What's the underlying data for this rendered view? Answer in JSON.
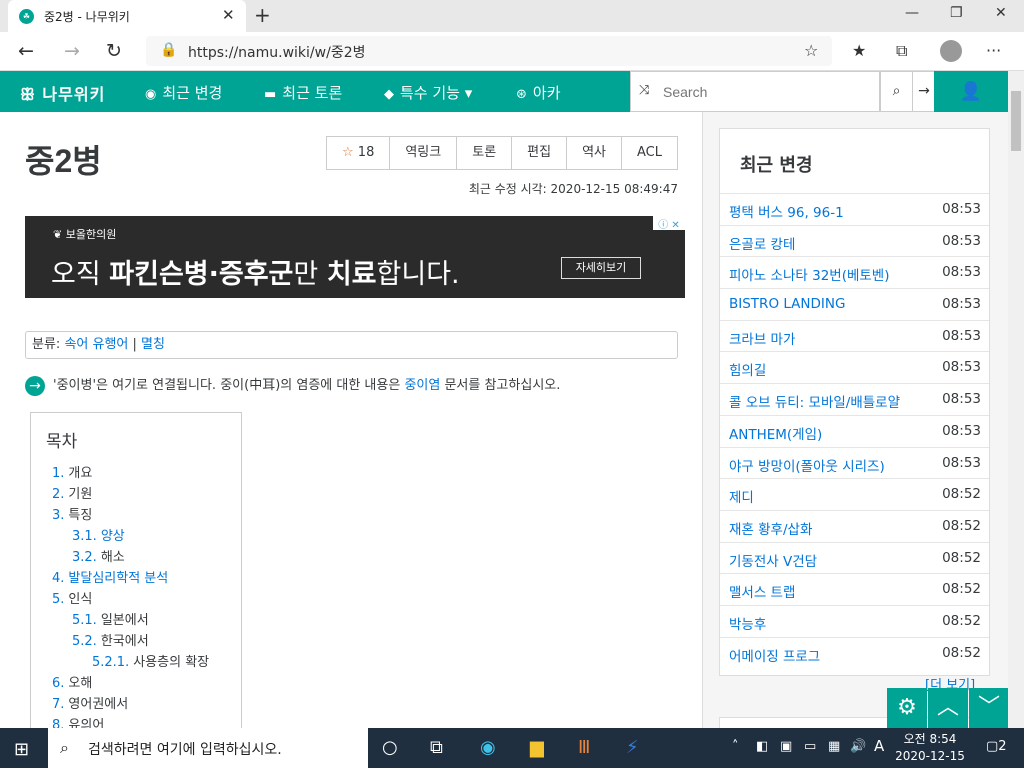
{
  "browser": {
    "tab_title": "중2병 - 나무위키",
    "tab_favicon": "namu-icon",
    "url": "https://namu.wiki/w/중2병",
    "window_buttons": [
      "—",
      "❐",
      "✕"
    ]
  },
  "nav": {
    "logo": "나무위키",
    "items": [
      {
        "label": "최근 변경",
        "icon": "compass-icon"
      },
      {
        "label": "최근 토론",
        "icon": "comment-icon"
      },
      {
        "label": "특수 기능",
        "icon": "cube-icon"
      },
      {
        "label": "아카",
        "icon": "arca-icon"
      }
    ],
    "search_placeholder": "Search",
    "accent": "#00a495"
  },
  "article": {
    "title": "중2병",
    "star_count": "18",
    "actions": [
      "역링크",
      "토론",
      "편집",
      "역사",
      "ACL"
    ],
    "last_modified": "최근 수정 시각: 2020-12-15 08:49:47",
    "ad": {
      "brand": "보올한의원",
      "copy_1": "오직 ",
      "copy_2": "파킨슨병·증후군",
      "copy_3": "만 ",
      "copy_4": "치료",
      "copy_5": "합니다.",
      "button": "자세히보기"
    },
    "category_label": "분류",
    "categories": [
      "속어 유행어",
      "멸칭"
    ],
    "redirect_1": "'중이병'은 여기로 연결됩니다. 중이(中耳)의 염증에 대한 내용은 ",
    "redirect_link": "중이염",
    "redirect_2": " 문서를 참고하십시오.",
    "toc_title": "목차",
    "toc": [
      {
        "num": "1.",
        "label": "개요",
        "level": 1,
        "linked": false
      },
      {
        "num": "2.",
        "label": "기원",
        "level": 1,
        "linked": false
      },
      {
        "num": "3.",
        "label": "특징",
        "level": 1,
        "linked": false
      },
      {
        "num": "3.1.",
        "label": "양상",
        "level": 2,
        "linked": true
      },
      {
        "num": "3.2.",
        "label": "해소",
        "level": 2,
        "linked": false
      },
      {
        "num": "4.",
        "label": "발달심리학적 분석",
        "level": 1,
        "linked": true
      },
      {
        "num": "5.",
        "label": "인식",
        "level": 1,
        "linked": false
      },
      {
        "num": "5.1.",
        "label": "일본에서",
        "level": 2,
        "linked": false
      },
      {
        "num": "5.2.",
        "label": "한국에서",
        "level": 2,
        "linked": false
      },
      {
        "num": "5.2.1.",
        "label": "사용층의 확장",
        "level": 3,
        "linked": false
      },
      {
        "num": "6.",
        "label": "오해",
        "level": 1,
        "linked": false
      },
      {
        "num": "7.",
        "label": "영어권에서",
        "level": 1,
        "linked": false
      },
      {
        "num": "8.",
        "label": "유의어",
        "level": 1,
        "linked": false
      }
    ]
  },
  "sidebar": {
    "title": "최근 변경",
    "more": "[더 보기]",
    "items": [
      {
        "name": "평택 버스 96, 96-1",
        "time": "08:53"
      },
      {
        "name": "은골로 캉테",
        "time": "08:53"
      },
      {
        "name": "피아노 소나타 32번(베토벤)",
        "time": "08:53"
      },
      {
        "name": "BISTRO LANDING",
        "time": "08:53"
      },
      {
        "name": "크라브 마가",
        "time": "08:53"
      },
      {
        "name": "힘의길",
        "time": "08:53"
      },
      {
        "name": "콜 오브 듀티: 모바일/배틀로얄",
        "time": "08:53"
      },
      {
        "name": "ANTHEM(게임)",
        "time": "08:53"
      },
      {
        "name": "야구 방망이(폴아웃 시리즈)",
        "time": "08:53"
      },
      {
        "name": "제디",
        "time": "08:52"
      },
      {
        "name": "재혼 황후/삽화",
        "time": "08:52"
      },
      {
        "name": "기동전사 V건담",
        "time": "08:52"
      },
      {
        "name": "맬서스 트랩",
        "time": "08:52"
      },
      {
        "name": "박능후",
        "time": "08:52"
      },
      {
        "name": "어메이징 프로그",
        "time": "08:52"
      }
    ]
  },
  "taskbar": {
    "search_placeholder": "검색하려면 여기에 입력하십시오.",
    "ime": "A",
    "clock_ampm_time": "오전 8:54",
    "clock_date": "2020-12-15",
    "notifications": "2"
  }
}
